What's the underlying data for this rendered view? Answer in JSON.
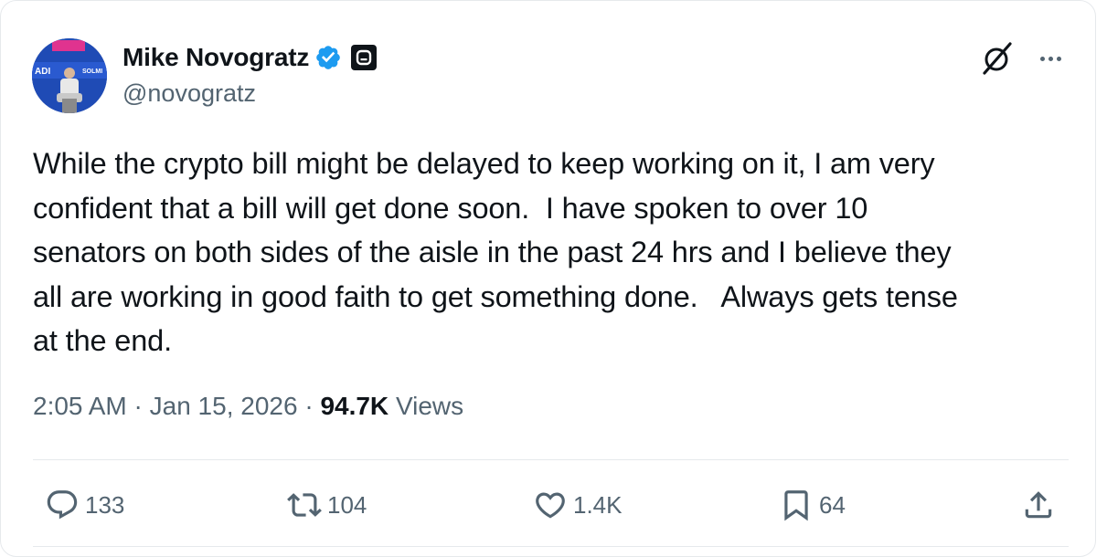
{
  "author": {
    "name": "Mike Novogratz",
    "handle": "@novogratz",
    "avatar_icon": "avatar-photo",
    "verified_icon": "verified-badge-icon",
    "affiliation_icon": "affiliation-badge-icon",
    "verified_color": "#1d9bf0"
  },
  "header_icons": {
    "grok": "grok-icon",
    "more": "more-icon"
  },
  "tweet": {
    "text": "While the crypto bill might be delayed to keep working on it, I am very\nconfident that a bill will get done soon.  I have spoken to over 10\nsenators on both sides of the aisle in the past 24 hrs and I believe they\nall are working in good faith to get something done.   Always gets tense\nat the end.",
    "time": "2:05 AM",
    "separator": "·",
    "date": "Jan 15, 2026",
    "views_count": "94.7K",
    "views_label": "Views"
  },
  "actions": {
    "reply": {
      "icon": "reply-icon",
      "count": "133"
    },
    "repost": {
      "icon": "repost-icon",
      "count": "104"
    },
    "like": {
      "icon": "heart-icon",
      "count": "1.4K"
    },
    "bookmark": {
      "icon": "bookmark-icon",
      "count": "64"
    },
    "share": {
      "icon": "share-icon"
    }
  },
  "colors": {
    "text_primary": "#0f1419",
    "text_secondary": "#536471",
    "border": "#e6e9ec"
  }
}
